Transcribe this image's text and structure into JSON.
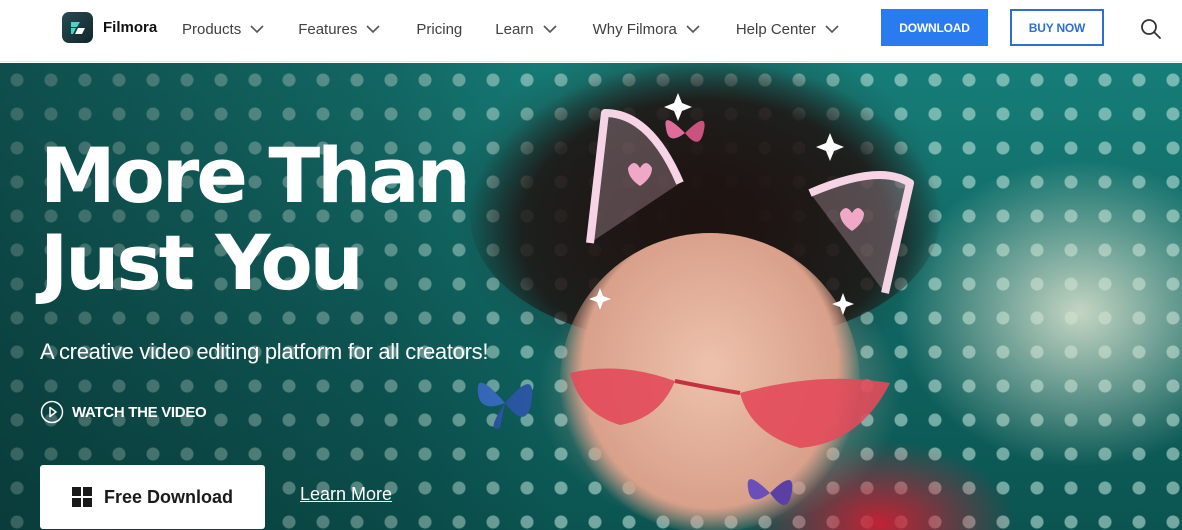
{
  "nav": {
    "brand": "Filmora",
    "items": [
      {
        "label": "Products",
        "has_dropdown": true
      },
      {
        "label": "Features",
        "has_dropdown": true
      },
      {
        "label": "Pricing",
        "has_dropdown": false
      },
      {
        "label": "Learn",
        "has_dropdown": true
      },
      {
        "label": "Why Filmora",
        "has_dropdown": true
      },
      {
        "label": "Help Center",
        "has_dropdown": true
      }
    ],
    "download_label": "DOWNLOAD",
    "buy_label": "BUY NOW",
    "search_icon": "search-icon"
  },
  "hero": {
    "title_line1": "More Than",
    "title_line2": "Just You",
    "subtitle": "A creative video editing platform for all creators!",
    "watch_label": "WATCH THE VIDEO",
    "free_download_label": "Free Download",
    "learn_more_label": "Learn More",
    "icons": {
      "play": "play-circle-icon",
      "windows": "windows-icon"
    }
  },
  "colors": {
    "accent": "#2b7bf0",
    "buy_border": "#2b6fd6",
    "hero_teal": "#167d78",
    "text_nav": "#404040"
  }
}
